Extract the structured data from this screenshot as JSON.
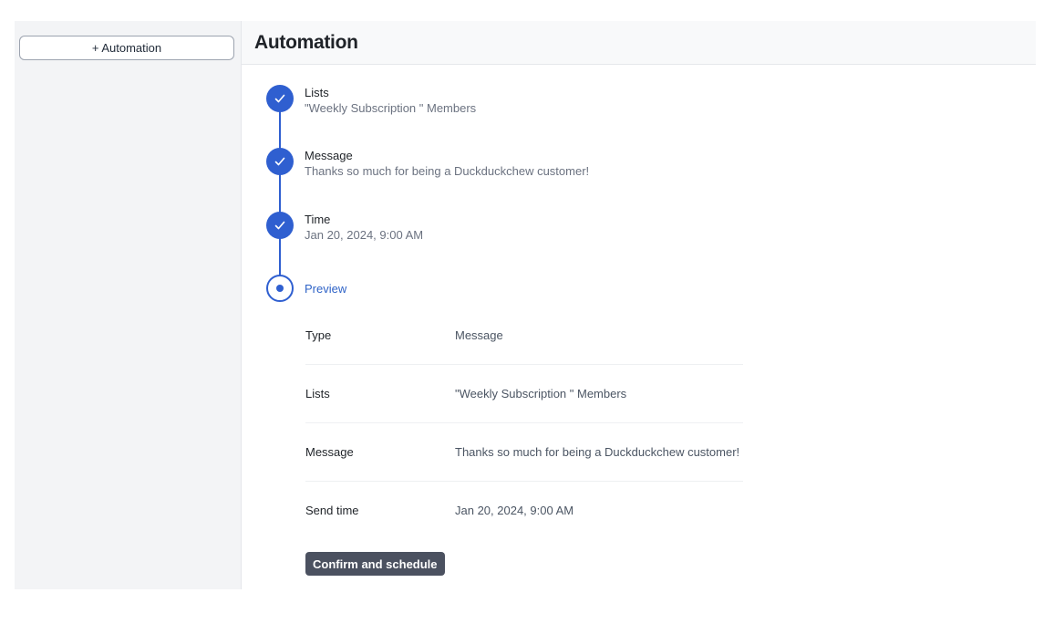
{
  "sidebar": {
    "add_button_label": "+ Automation"
  },
  "header": {
    "title": "Automation"
  },
  "steps": [
    {
      "title": "Lists",
      "subtitle": "\"Weekly Subscription \" Members",
      "state": "done"
    },
    {
      "title": "Message",
      "subtitle": "Thanks so much for being a Duckduckchew customer!",
      "state": "done"
    },
    {
      "title": "Time",
      "subtitle": "Jan 20, 2024, 9:00 AM",
      "state": "done"
    },
    {
      "title": "Preview",
      "subtitle": "",
      "state": "current"
    }
  ],
  "preview": {
    "rows": [
      {
        "label": "Type",
        "value": "Message"
      },
      {
        "label": "Lists",
        "value": "\"Weekly Subscription \" Members"
      },
      {
        "label": "Message",
        "value": "Thanks so much for being a Duckduckchew customer!"
      },
      {
        "label": "Send time",
        "value": "Jan 20, 2024, 9:00 AM"
      }
    ]
  },
  "actions": {
    "confirm_label": "Confirm and schedule"
  },
  "colors": {
    "accent": "#2f5fd0",
    "button_dark": "#4b5160",
    "sidebar_bg": "#f3f4f6"
  },
  "icons": {
    "done": "check-icon",
    "current": "dot-icon"
  }
}
